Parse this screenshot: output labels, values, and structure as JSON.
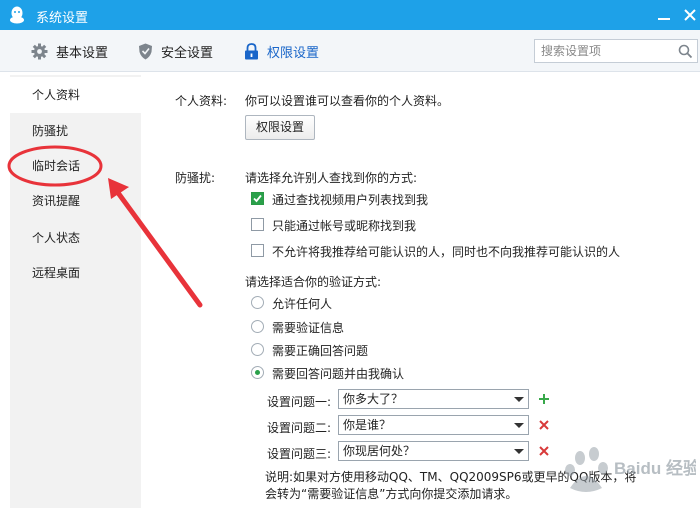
{
  "window": {
    "title": "系统设置"
  },
  "toolbar": {
    "tabs": [
      {
        "label": "基本设置",
        "icon": "gear-icon"
      },
      {
        "label": "安全设置",
        "icon": "shield-icon"
      },
      {
        "label": "权限设置",
        "icon": "lock-icon",
        "active": true
      }
    ],
    "search_placeholder": "搜索设置项"
  },
  "sidebar": {
    "items": [
      {
        "label": "个人资料",
        "active": true
      },
      {
        "label": "防骚扰"
      },
      {
        "label": "临时会话"
      },
      {
        "label": "资讯提醒"
      },
      {
        "label": "个人状态"
      },
      {
        "label": "远程桌面"
      }
    ]
  },
  "profile": {
    "label": "个人资料:",
    "description": "你可以设置谁可以查看你的个人资料。",
    "button": "权限设置"
  },
  "harassment": {
    "label": "防骚扰:",
    "find_title": "请选择允许别人查找到你的方式:",
    "find_options": [
      {
        "label": "通过查找视频用户列表找到我",
        "checked": true
      },
      {
        "label": "只能通过帐号或昵称找到我",
        "checked": false
      },
      {
        "label": "不允许将我推荐给可能认识的人，同时也不向我推荐可能认识的人",
        "checked": false
      }
    ],
    "verify_title": "请选择适合你的验证方式:",
    "verify_options": [
      {
        "label": "允许任何人",
        "selected": false
      },
      {
        "label": "需要验证信息",
        "selected": false
      },
      {
        "label": "需要正确回答问题",
        "selected": false
      },
      {
        "label": "需要回答问题并由我确认",
        "selected": true
      }
    ],
    "questions": [
      {
        "label": "设置问题一:",
        "value": "你多大了？",
        "action": "plus-icon"
      },
      {
        "label": "设置问题二:",
        "value": "你是谁？",
        "action": "remove-icon"
      },
      {
        "label": "设置问题三:",
        "value": "你现居何处？",
        "action": "remove-icon"
      }
    ],
    "note": "说明:如果对方使用移动QQ、TM、QQ2009SP6或更早的QQ版本，将会转为“需要验证信息”方式向你提交添加请求。"
  },
  "watermark": {
    "text": "Baidu 经验"
  },
  "colors": {
    "titlebar": "#1ea1e8",
    "active_tab": "#1a66c9",
    "check_green": "#2aa04a",
    "annotation_red": "#e8333a"
  }
}
